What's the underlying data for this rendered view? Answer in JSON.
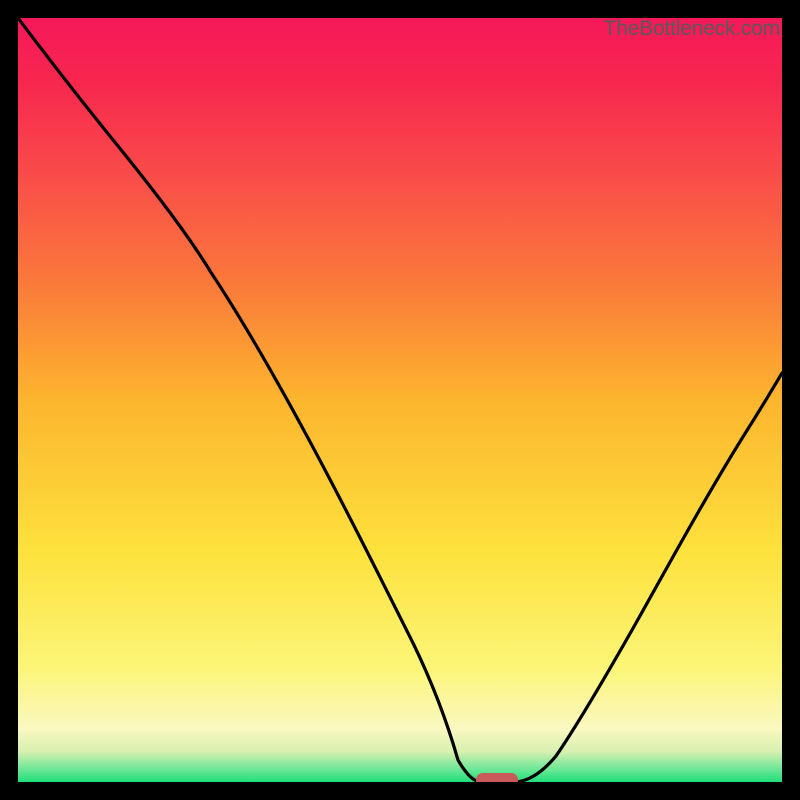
{
  "watermark": "TheBottleneck.com",
  "colors": {
    "frame": "#000000",
    "curve": "#000000",
    "marker": "#c85a5a",
    "gradient_stops": [
      "#20e07a",
      "#7ae89a",
      "#d8f0b0",
      "#faf8c0",
      "#fcf577",
      "#fde23d",
      "#fcb52e",
      "#fa7a3a",
      "#f94a4a",
      "#f7264e",
      "#f5185a"
    ]
  },
  "chart_data": {
    "type": "line",
    "title": "",
    "xlabel": "",
    "ylabel": "",
    "xlim": [
      0,
      100
    ],
    "ylim": [
      0,
      100
    ],
    "grid": false,
    "legend": false,
    "x": [
      0,
      5,
      10,
      15,
      20,
      25,
      30,
      35,
      40,
      45,
      50,
      55,
      57,
      60,
      63,
      65,
      70,
      75,
      80,
      85,
      90,
      95,
      100
    ],
    "values": [
      100,
      93,
      86,
      79,
      73,
      67,
      58,
      48,
      38,
      28,
      17,
      6,
      2,
      0,
      0,
      0,
      3,
      10,
      20,
      32,
      45,
      55,
      64
    ],
    "marker": {
      "label": "",
      "x_range": [
        60,
        65
      ],
      "y": 0
    },
    "notes": "Heat-gradient bottleneck chart. y=100 is max bottleneck (red), y=0 is optimal (green). Curve dips to a flat minimum around x≈60–65 then rises again."
  }
}
